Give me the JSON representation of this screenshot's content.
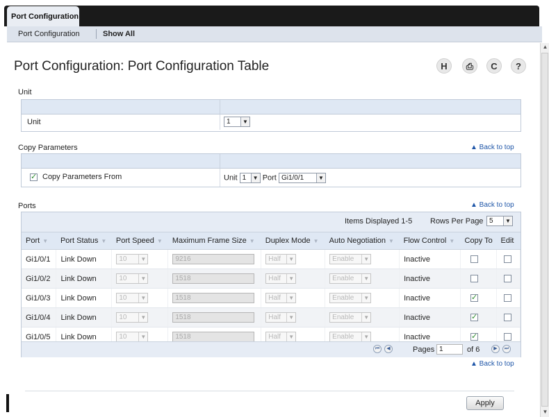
{
  "tab": {
    "label": "Port Configuration"
  },
  "subnav": {
    "items": [
      "Port Configuration",
      "Show All"
    ]
  },
  "page": {
    "title": "Port Configuration: Port Configuration Table"
  },
  "toolbar": {
    "save_icon": "H",
    "print_icon": "⎙",
    "refresh_icon": "C",
    "help_icon": "?"
  },
  "unit_section": {
    "title": "Unit",
    "label": "Unit",
    "value": "1"
  },
  "copy_section": {
    "title": "Copy Parameters",
    "back_to_top": "▲ Back to top",
    "checkbox_label": "Copy Parameters From",
    "unit_label": "Unit",
    "unit_value": "1",
    "port_label": "Port",
    "port_value": "Gi1/0/1"
  },
  "ports_section": {
    "title": "Ports",
    "back_to_top": "▲ Back to top",
    "items_displayed": "Items Displayed 1-5",
    "rows_per_page_label": "Rows Per Page",
    "rows_per_page_value": "5",
    "columns": [
      "Port",
      "Port Status",
      "Port Speed",
      "Maximum Frame Size",
      "Duplex Mode",
      "Auto Negotiation",
      "Flow Control",
      "Copy To",
      "Edit"
    ],
    "rows": [
      {
        "port": "Gi1/0/1",
        "status": "Link Down",
        "speed": "10",
        "frame": "9216",
        "duplex": "Half",
        "autoneg": "Enable",
        "flow": "Inactive",
        "copy_to": false,
        "edit": false
      },
      {
        "port": "Gi1/0/2",
        "status": "Link Down",
        "speed": "10",
        "frame": "1518",
        "duplex": "Half",
        "autoneg": "Enable",
        "flow": "Inactive",
        "copy_to": false,
        "edit": false
      },
      {
        "port": "Gi1/0/3",
        "status": "Link Down",
        "speed": "10",
        "frame": "1518",
        "duplex": "Half",
        "autoneg": "Enable",
        "flow": "Inactive",
        "copy_to": true,
        "edit": false
      },
      {
        "port": "Gi1/0/4",
        "status": "Link Down",
        "speed": "10",
        "frame": "1518",
        "duplex": "Half",
        "autoneg": "Enable",
        "flow": "Inactive",
        "copy_to": true,
        "edit": false
      },
      {
        "port": "Gi1/0/5",
        "status": "Link Down",
        "speed": "10",
        "frame": "1518",
        "duplex": "Half",
        "autoneg": "Enable",
        "flow": "Inactive",
        "copy_to": true,
        "edit": false
      }
    ],
    "pages_label": "Pages",
    "page_value": "1",
    "of_pages": "of 6",
    "bottom_back_to_top": "▲ Back to top"
  },
  "actions": {
    "apply": "Apply"
  }
}
